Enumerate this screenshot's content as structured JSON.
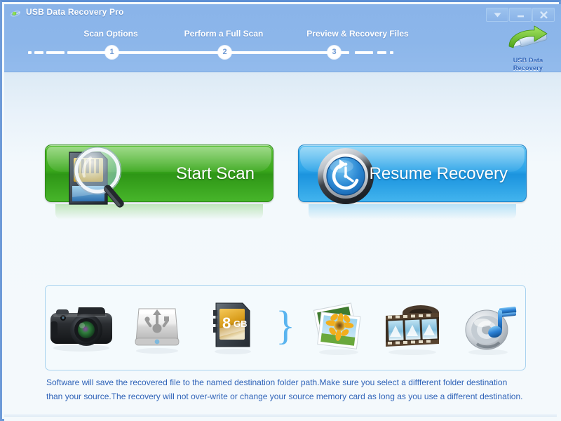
{
  "window": {
    "title": "USB Data Recovery Pro",
    "app_icon": "usb-recovery-icon",
    "controls": [
      {
        "name": "collapse-button",
        "icon": "chevron-down-icon",
        "label": "▼"
      },
      {
        "name": "minimize-button",
        "icon": "minimize-icon",
        "label": "–"
      },
      {
        "name": "close-button",
        "icon": "close-icon",
        "label": "✕"
      }
    ]
  },
  "brand": {
    "line1": "USB Data",
    "line2": "Recovery",
    "icon": "usb-drive-arrow-icon"
  },
  "steps": [
    {
      "number": "1",
      "label": "Scan Options"
    },
    {
      "number": "2",
      "label": "Perform a Full Scan"
    },
    {
      "number": "3",
      "label": "Preview & Recovery Files"
    }
  ],
  "actions": {
    "start_scan": {
      "label": "Start Scan",
      "icon": "memory-card-magnifier-icon",
      "color": "#3aa81c"
    },
    "resume_recovery": {
      "label": "Resume Recovery",
      "icon": "clock-rewind-icon",
      "color": "#2ba3e8"
    }
  },
  "devices": [
    {
      "name": "camera-icon",
      "label": "Digital Camera"
    },
    {
      "name": "usb-drive-icon",
      "label": "USB Drive"
    },
    {
      "name": "sd-card-icon",
      "label": "SD Card",
      "capacity_number": "8",
      "capacity_unit": "GB"
    },
    {
      "name": "brace-separator",
      "label": "}"
    },
    {
      "name": "photos-icon",
      "label": "Photos"
    },
    {
      "name": "video-film-icon",
      "label": "Videos"
    },
    {
      "name": "audio-speaker-icon",
      "label": "Audio"
    }
  ],
  "note": {
    "text": "Software will save the recovered file to the named destination folder path.Make sure you select a diffferent folder destination than your source.The recovery will not over-write or change your source memory card as long as you use a different destination."
  },
  "colors": {
    "header_blue": "#8cb6ea",
    "frame_blue": "#6d9ad8",
    "body_white": "#f4f9fc",
    "accent_text": "#2f63b8",
    "green": "#3aa81c",
    "blue": "#2ba3e8",
    "panel_border": "#a9d3ef"
  }
}
